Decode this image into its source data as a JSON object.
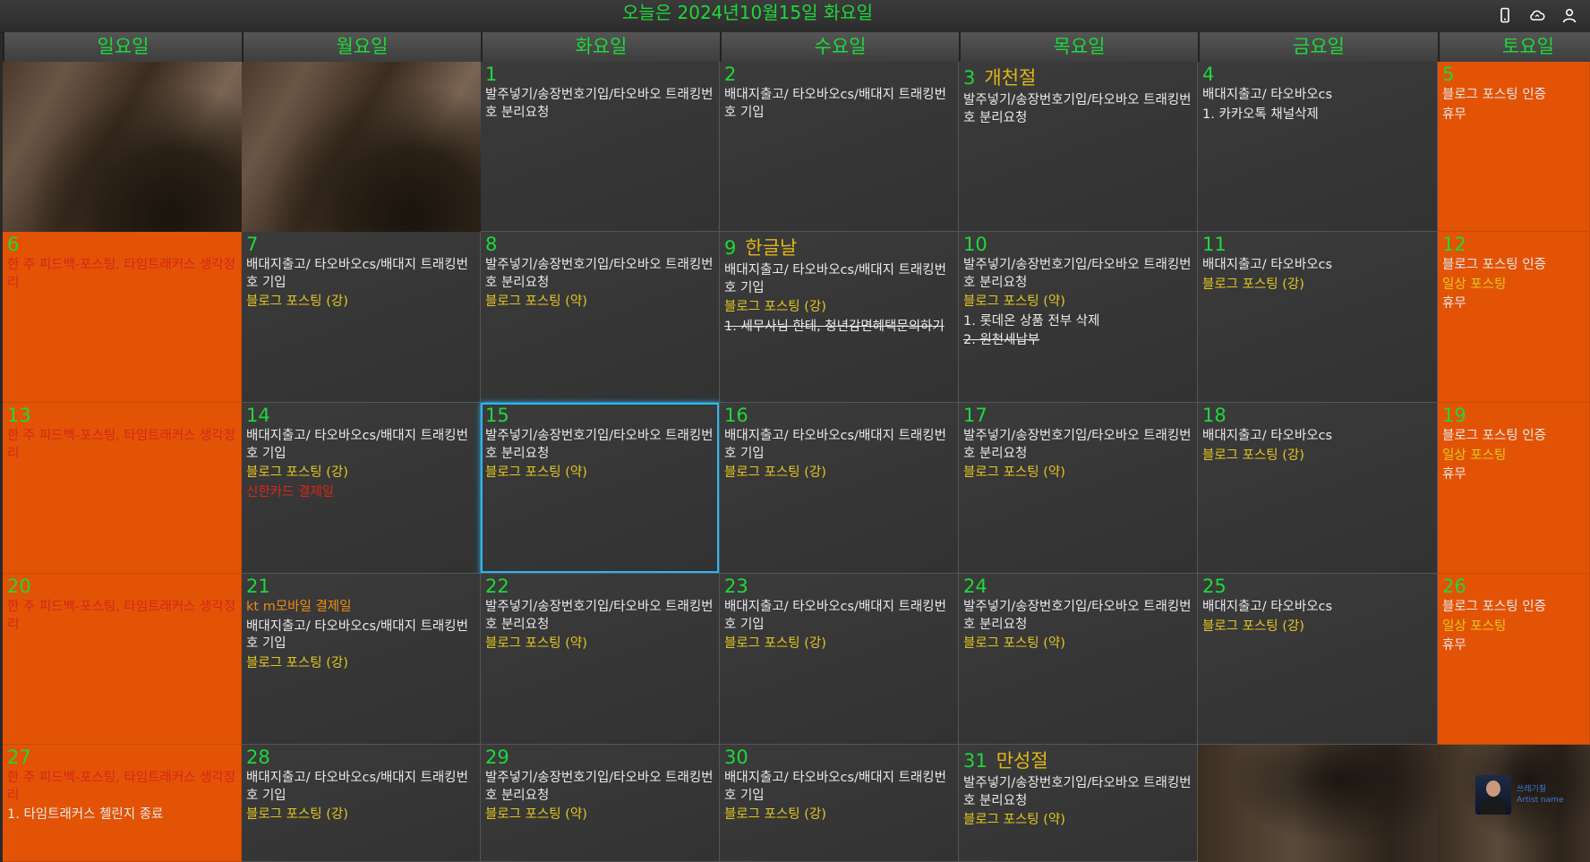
{
  "title": "오늘은 2024년10월15일 화요일",
  "toolbar_icons": [
    "phone-icon",
    "cloud-sync-icon",
    "user-icon"
  ],
  "weekdays": [
    "일요일",
    "월요일",
    "화요일",
    "수요일",
    "목요일",
    "금요일",
    "토요일"
  ],
  "colors": {
    "accent_green": "#1fd83a",
    "weekend_orange": "#e25306",
    "yellow_event": "#e3c820",
    "red_event": "#d8261a",
    "today_border": "#29b6f6"
  },
  "avatar": {
    "line1": "쓰레기칠",
    "line2": "Artist name"
  },
  "weeks": [
    [
      {
        "type": "photo"
      },
      {
        "type": "photo"
      },
      {
        "day": "1",
        "events": [
          {
            "text": "발주넣기/송장번호기입/타오바오 트래킹번호 분리요청",
            "c": "w"
          }
        ]
      },
      {
        "day": "2",
        "events": [
          {
            "text": "배대지출고/  타오바오cs/배대지 트래킹번호 기입",
            "c": "w"
          }
        ]
      },
      {
        "day": "3",
        "holiday": "개천절",
        "events": [
          {
            "text": "발주넣기/송장번호기입/타오바오 트래킹번호 분리요청",
            "c": "w"
          }
        ]
      },
      {
        "day": "4",
        "events": [
          {
            "text": "배대지출고/  타오바오cs",
            "c": "w"
          },
          {
            "text": "1. 카카오톡 채널삭제",
            "c": "w"
          }
        ]
      },
      {
        "day": "5",
        "weekend": true,
        "events": [
          {
            "text": "블로그 포스팅 인증",
            "c": "w"
          },
          {
            "text": "휴무",
            "c": "w"
          }
        ]
      }
    ],
    [
      {
        "day": "6",
        "weekend": true,
        "events": [
          {
            "text": "한 주 피드백-포스팅, 타임트래커스 생각정리",
            "c": "r"
          }
        ]
      },
      {
        "day": "7",
        "events": [
          {
            "text": "배대지출고/  타오바오cs/배대지 트래킹번호 기입",
            "c": "w"
          },
          {
            "text": "블로그 포스팅 (강)",
            "c": "y"
          }
        ]
      },
      {
        "day": "8",
        "events": [
          {
            "text": "발주넣기/송장번호기입/타오바오 트래킹번호 분리요청",
            "c": "w"
          },
          {
            "text": "블로그 포스팅 (약)",
            "c": "y"
          }
        ]
      },
      {
        "day": "9",
        "holiday": "한글날",
        "events": [
          {
            "text": "배대지출고/  타오바오cs/배대지 트래킹번호 기입",
            "c": "w"
          },
          {
            "text": "블로그 포스팅 (강)",
            "c": "y"
          },
          {
            "text": "1. 세무사님 한테, 청년감면혜택문의하기",
            "c": "w",
            "strike": true
          }
        ]
      },
      {
        "day": "10",
        "events": [
          {
            "text": "발주넣기/송장번호기입/타오바오 트래킹번호 분리요청",
            "c": "w"
          },
          {
            "text": "블로그 포스팅 (약)",
            "c": "y"
          },
          {
            "text": "1. 롯데온 상품 전부 삭제",
            "c": "w"
          },
          {
            "text": "2. 원천세납부",
            "c": "w",
            "strike": true
          }
        ]
      },
      {
        "day": "11",
        "events": [
          {
            "text": "배대지출고/  타오바오cs",
            "c": "w"
          },
          {
            "text": "블로그 포스팅 (강)",
            "c": "y"
          }
        ]
      },
      {
        "day": "12",
        "weekend": true,
        "events": [
          {
            "text": "블로그 포스팅 인증",
            "c": "w"
          },
          {
            "text": "일상 포스팅",
            "c": "y"
          },
          {
            "text": "휴무",
            "c": "w"
          }
        ]
      }
    ],
    [
      {
        "day": "13",
        "weekend": true,
        "events": [
          {
            "text": "한 주 피드백-포스팅, 타임트래커스 생각정리",
            "c": "r"
          }
        ]
      },
      {
        "day": "14",
        "events": [
          {
            "text": "배대지출고/  타오바오cs/배대지 트래킹번호 기입",
            "c": "w"
          },
          {
            "text": "블로그 포스팅 (강)",
            "c": "y"
          },
          {
            "text": "신한카드 결제일",
            "c": "r"
          }
        ]
      },
      {
        "day": "15",
        "today": true,
        "events": [
          {
            "text": "발주넣기/송장번호기입/타오바오 트래킹번호 분리요청",
            "c": "w"
          },
          {
            "text": "블로그 포스팅 (약)",
            "c": "y"
          }
        ]
      },
      {
        "day": "16",
        "events": [
          {
            "text": "배대지출고/  타오바오cs/배대지 트래킹번호 기입",
            "c": "w"
          },
          {
            "text": "블로그 포스팅 (강)",
            "c": "y"
          }
        ]
      },
      {
        "day": "17",
        "events": [
          {
            "text": "발주넣기/송장번호기입/타오바오 트래킹번호 분리요청",
            "c": "w"
          },
          {
            "text": "블로그 포스팅 (약)",
            "c": "y"
          }
        ]
      },
      {
        "day": "18",
        "events": [
          {
            "text": "배대지출고/  타오바오cs",
            "c": "w"
          },
          {
            "text": "블로그 포스팅 (강)",
            "c": "y"
          }
        ]
      },
      {
        "day": "19",
        "weekend": true,
        "events": [
          {
            "text": "블로그 포스팅 인증",
            "c": "w"
          },
          {
            "text": "일상 포스팅",
            "c": "y"
          },
          {
            "text": "휴무",
            "c": "w"
          }
        ]
      }
    ],
    [
      {
        "day": "20",
        "weekend": true,
        "events": [
          {
            "text": "한 주 피드백-포스팅, 타임트래커스 생각정리",
            "c": "r"
          }
        ]
      },
      {
        "day": "21",
        "events": [
          {
            "text": "kt m모바일 결제일",
            "c": "o"
          },
          {
            "text": "배대지출고/  타오바오cs/배대지 트래킹번호 기입",
            "c": "w"
          },
          {
            "text": "블로그 포스팅 (강)",
            "c": "y"
          }
        ]
      },
      {
        "day": "22",
        "events": [
          {
            "text": "발주넣기/송장번호기입/타오바오 트래킹번호 분리요청",
            "c": "w"
          },
          {
            "text": "블로그 포스팅 (약)",
            "c": "y"
          }
        ]
      },
      {
        "day": "23",
        "events": [
          {
            "text": "배대지출고/  타오바오cs/배대지 트래킹번호 기입",
            "c": "w"
          },
          {
            "text": "블로그 포스팅 (강)",
            "c": "y"
          }
        ]
      },
      {
        "day": "24",
        "events": [
          {
            "text": "발주넣기/송장번호기입/타오바오 트래킹번호 분리요청",
            "c": "w"
          },
          {
            "text": "블로그 포스팅 (약)",
            "c": "y"
          }
        ]
      },
      {
        "day": "25",
        "events": [
          {
            "text": "배대지출고/  타오바오cs",
            "c": "w"
          },
          {
            "text": "블로그 포스팅 (강)",
            "c": "y"
          }
        ]
      },
      {
        "day": "26",
        "weekend": true,
        "events": [
          {
            "text": "블로그 포스팅 인증",
            "c": "w"
          },
          {
            "text": "일상 포스팅",
            "c": "y"
          },
          {
            "text": "휴무",
            "c": "w"
          }
        ]
      }
    ],
    [
      {
        "day": "27",
        "weekend": true,
        "events": [
          {
            "text": "한 주 피드백-포스팅, 타임트래커스 생각정리",
            "c": "r"
          },
          {
            "text": "1. 타임트래커스 첼린지 종료",
            "c": "w"
          }
        ]
      },
      {
        "day": "28",
        "events": [
          {
            "text": "배대지출고/  타오바오cs/배대지 트래킹번호 기입",
            "c": "w"
          },
          {
            "text": "블로그 포스팅 (강)",
            "c": "y"
          }
        ]
      },
      {
        "day": "29",
        "events": [
          {
            "text": "발주넣기/송장번호기입/타오바오 트래킹번호 분리요청",
            "c": "w"
          },
          {
            "text": "블로그 포스팅 (약)",
            "c": "y"
          }
        ]
      },
      {
        "day": "30",
        "events": [
          {
            "text": "배대지출고/  타오바오cs/배대지 트래킹번호 기입",
            "c": "w"
          },
          {
            "text": "블로그 포스팅 (강)",
            "c": "y"
          }
        ]
      },
      {
        "day": "31",
        "holiday": "만성절",
        "events": [
          {
            "text": "발주넣기/송장번호기입/타오바오 트래킹번호 분리요청",
            "c": "w"
          },
          {
            "text": "블로그 포스팅 (약)",
            "c": "y"
          }
        ]
      },
      {
        "type": "photo2"
      },
      {
        "type": "photo2",
        "avatar": true
      }
    ]
  ]
}
